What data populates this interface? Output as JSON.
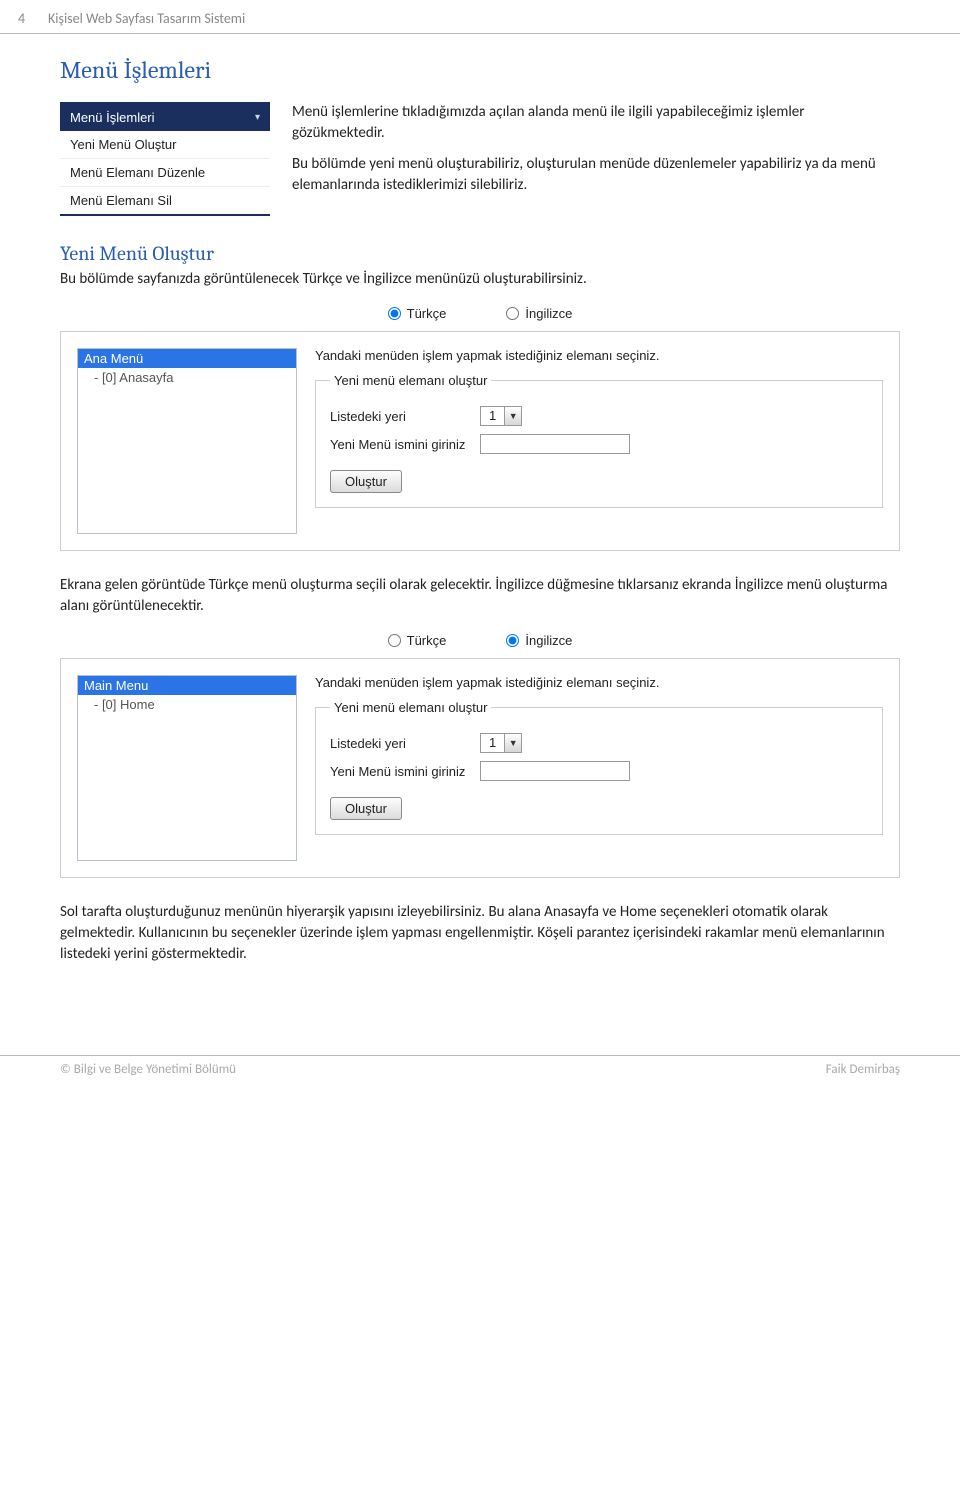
{
  "header": {
    "page_number": "4",
    "doc_title": "Kişisel Web Sayfası Tasarım Sistemi"
  },
  "section": {
    "title": "Menü İşlemleri"
  },
  "menu_panel": {
    "header": "Menü İşlemleri",
    "items": [
      "Yeni Menü Oluştur",
      "Menü Elemanı Düzenle",
      "Menü Elemanı Sil"
    ]
  },
  "intro": {
    "p1": "Menü işlemlerine tıkladığımızda açılan alanda menü ile ilgili yapabileceğimiz işlemler gözükmektedir.",
    "p2": "Bu bölümde yeni menü oluşturabiliriz, oluşturulan menüde düzenlemeler yapabiliriz ya da menü elemanlarında istediklerimizi silebiliriz."
  },
  "subsection_new_menu": {
    "title": "Yeni Menü Oluştur",
    "desc": "Bu bölümde sayfanızda görüntülenecek Türkçe ve İngilizce menünüzü oluşturabilirsiniz."
  },
  "lang_labels": {
    "tr": "Türkçe",
    "en": "İngilizce"
  },
  "panel1": {
    "tree_header": "Ana Menü",
    "tree_item": "- [0] Anasayfa",
    "instruction": "Yandaki menüden işlem yapmak istediğiniz elemanı seçiniz.",
    "legend": "Yeni menü elemanı oluştur",
    "pos_label": "Listedeki yeri",
    "pos_value": "1",
    "name_label": "Yeni Menü ismini giriniz",
    "create_btn": "Oluştur"
  },
  "para_after1": "Ekrana gelen görüntüde Türkçe menü oluşturma seçili olarak gelecektir. İngilizce düğmesine tıklarsanız ekranda İngilizce menü oluşturma alanı görüntülenecektir.",
  "panel2": {
    "tree_header": "Main Menu",
    "tree_item": "- [0] Home",
    "instruction": "Yandaki menüden işlem yapmak istediğiniz elemanı seçiniz.",
    "legend": "Yeni menü elemanı oluştur",
    "pos_label": "Listedeki yeri",
    "pos_value": "1",
    "name_label": "Yeni Menü ismini giriniz",
    "create_btn": "Oluştur"
  },
  "para_after2": "Sol tarafta oluşturduğunuz menünün hiyerarşik yapısını izleyebilirsiniz. Bu alana Anasayfa ve Home seçenekleri otomatik olarak gelmektedir. Kullanıcının bu seçenekler üzerinde işlem yapması engellenmiştir. Köşeli parantez içerisindeki rakamlar menü elemanlarının listedeki yerini göstermektedir.",
  "footer": {
    "left": "© Bilgi ve Belge Yönetimi Bölümü",
    "right": "Faik Demirbaş"
  }
}
